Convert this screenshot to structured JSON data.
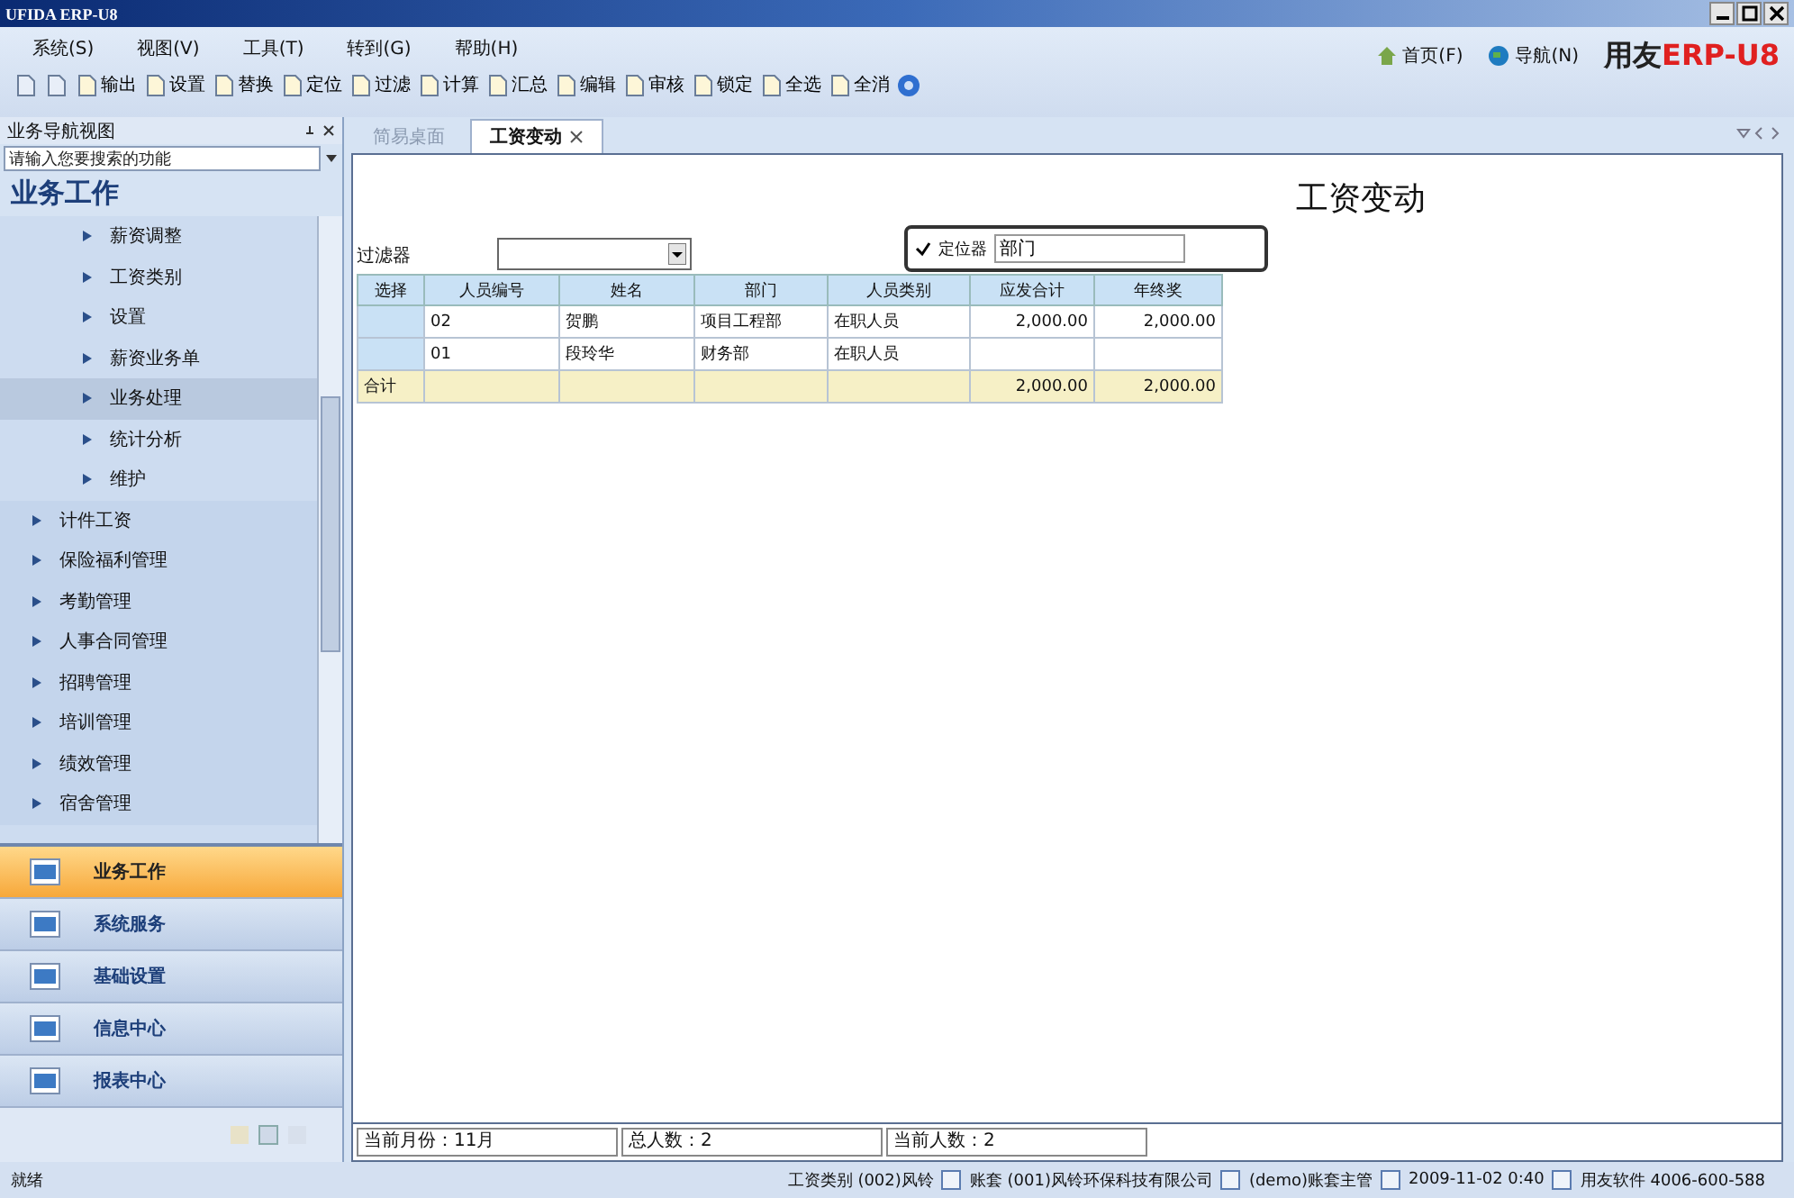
{
  "window": {
    "title": "UFIDA ERP-U8"
  },
  "menu": [
    "系统(S)",
    "视图(V)",
    "工具(T)",
    "转到(G)",
    "帮助(H)"
  ],
  "toolbar": [
    {
      "kind": "icon"
    },
    {
      "kind": "icon"
    },
    {
      "kind": "labeled",
      "label": "输出"
    },
    {
      "kind": "labeled",
      "label": "设置"
    },
    {
      "kind": "labeled",
      "label": "替换"
    },
    {
      "kind": "labeled",
      "label": "定位"
    },
    {
      "kind": "labeled",
      "label": "过滤"
    },
    {
      "kind": "labeled",
      "label": "计算"
    },
    {
      "kind": "labeled",
      "label": "汇总"
    },
    {
      "kind": "labeled",
      "label": "编辑"
    },
    {
      "kind": "labeled",
      "label": "审核"
    },
    {
      "kind": "labeled",
      "label": "锁定"
    },
    {
      "kind": "labeled",
      "label": "全选"
    },
    {
      "kind": "labeled",
      "label": "全消"
    }
  ],
  "header_links": [
    "首页(F)",
    "导航(N)"
  ],
  "brand": {
    "prefix": "用友",
    "mark": "ERP-U8"
  },
  "sidebar": {
    "title": "业务导航视图",
    "search": {
      "placeholder": "请输入您要搜索的功能"
    },
    "section": "业务工作",
    "items": [
      {
        "label": "薪资调整",
        "selected": false
      },
      {
        "label": "工资类别",
        "selected": false
      },
      {
        "label": "设置",
        "selected": false
      },
      {
        "label": "薪资业务单",
        "selected": false
      },
      {
        "label": "业务处理",
        "selected": true
      },
      {
        "label": "统计分析",
        "selected": false
      },
      {
        "label": "维护",
        "selected": false
      }
    ],
    "groups": [
      "计件工资",
      "保险福利管理",
      "考勤管理",
      "人事合同管理",
      "招聘管理",
      "培训管理",
      "绩效管理",
      "宿舍管理"
    ],
    "nav": [
      {
        "label": "业务工作",
        "selected": true
      },
      {
        "label": "系统服务",
        "selected": false
      },
      {
        "label": "基础设置",
        "selected": false
      },
      {
        "label": "信息中心",
        "selected": false
      },
      {
        "label": "报表中心",
        "selected": false
      }
    ]
  },
  "tabs": [
    {
      "label": "简易桌面",
      "selected": false,
      "closable": false
    },
    {
      "label": "工资变动",
      "selected": true,
      "closable": true
    }
  ],
  "page": {
    "title": "工资变动",
    "filter_label": "过滤器",
    "locator": {
      "checked": true,
      "label": "定位器",
      "value": "部门"
    }
  },
  "table": {
    "columns": [
      "选择",
      "人员编号",
      "姓名",
      "部门",
      "人员类别",
      "应发合计",
      "年终奖"
    ],
    "rows": [
      {
        "id": "02",
        "name": "贺鹏",
        "dept": "项目工程部",
        "type": "在职人员",
        "pay": "2,000.00",
        "bonus": "2,000.00"
      },
      {
        "id": "01",
        "name": "段玲华",
        "dept": "财务部",
        "type": "在职人员"
      }
    ],
    "total": {
      "label": "合计",
      "pay": "2,000.00",
      "bonus": "2,000.00"
    }
  },
  "info_fields": [
    "当前月份：11月",
    "总人数：2",
    "当前人数：2"
  ],
  "status_bar": {
    "left": "就绪",
    "items": [
      "工资类别 (002)风铃",
      "账套 (001)风铃环保科技有限公司",
      "(demo)账套主管",
      "2009-11-02 0:40",
      "用友软件 4006-600-588"
    ]
  }
}
